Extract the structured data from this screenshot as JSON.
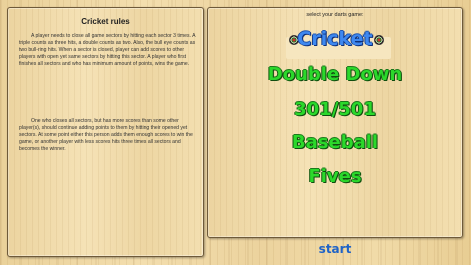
{
  "rules": {
    "title": "Cricket rules",
    "paragraph1": "A player needs to close all game sectors by hitting each sector 3 times. A triple counts as three hits, a double counts as two. Also, the bull eye counts as two bull-ring hits. When a sector is closed, player can add scores to other players with open yet same sectors by hitting this sector. A player who first finishes all sectors and who has minimum amount of points, wins the game.",
    "paragraph2": "One who closes all sectors, but has more scores than some other player(s), should continue adding points to them by hitting their opened yet sectors. At some point either this person adds them enough scores to win the game, or another player with less scores hits three times all sectors and becomes the winner."
  },
  "menu": {
    "header": "select your darts game:",
    "games": [
      "Cricket",
      "Double Down",
      "301/501",
      "Baseball",
      "Fives"
    ],
    "selected": "Cricket",
    "selected_color": "#3e88f0",
    "option_color": "#2bd82b"
  },
  "start_label": "start",
  "icons": {
    "selection_marker": "dartboard-icon"
  }
}
